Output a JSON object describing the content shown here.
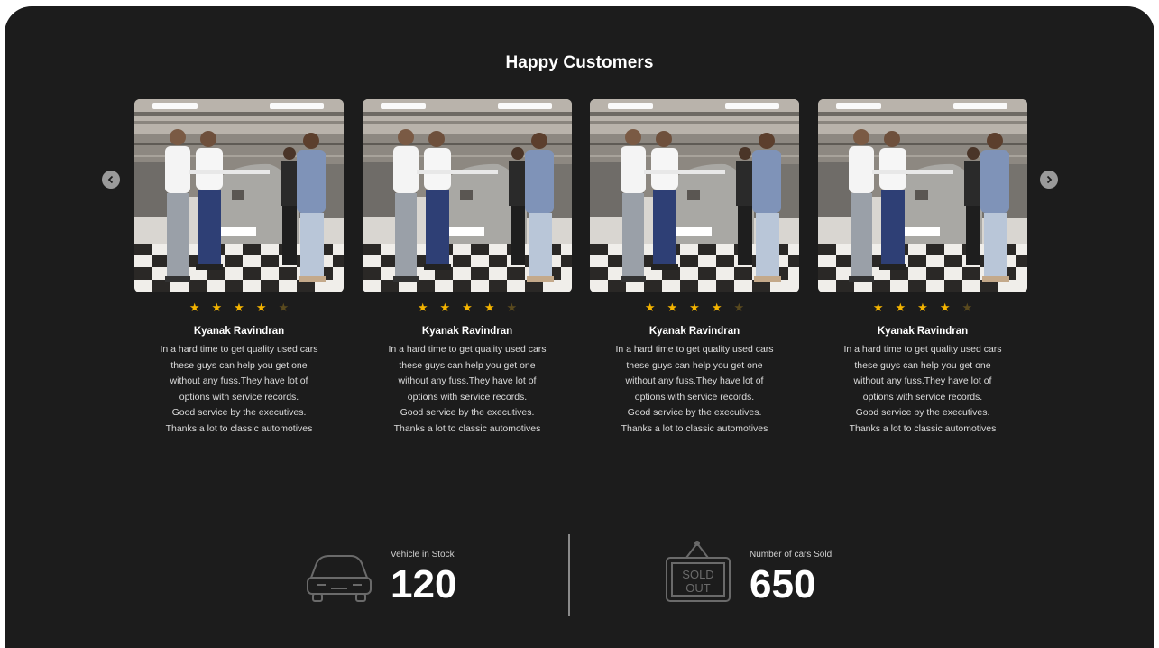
{
  "section": {
    "title": "Happy Customers"
  },
  "carousel": {
    "prev_icon": "chevron-left-icon",
    "next_icon": "chevron-right-icon",
    "cards": [
      {
        "rating": 4,
        "max_rating": 5,
        "name": "Kyanak Ravindran",
        "review": [
          "In a hard time to get quality used cars",
          "these guys can help you get one",
          "without any fuss.They have lot of",
          "options with service records.",
          "Good service by the executives.",
          "Thanks a lot to classic automotives"
        ]
      },
      {
        "rating": 4,
        "max_rating": 5,
        "name": "Kyanak Ravindran",
        "review": [
          "In a hard time to get quality used cars",
          "these guys can help you get one",
          "without any fuss.They have lot of",
          "options with service records.",
          "Good service by the executives.",
          "Thanks a lot to classic automotives"
        ]
      },
      {
        "rating": 4,
        "max_rating": 5,
        "name": "Kyanak Ravindran",
        "review": [
          "In a hard time to get quality used cars",
          "these guys can help you get one",
          "without any fuss.They have lot of",
          "options with service records.",
          "Good service by the executives.",
          "Thanks a lot to classic automotives"
        ]
      },
      {
        "rating": 4,
        "max_rating": 5,
        "name": "Kyanak Ravindran",
        "review": [
          "In a hard time to get quality used cars",
          "these guys can help you get one",
          "without any fuss.They have lot of",
          "options with service records.",
          "Good service by the executives.",
          "Thanks a lot to classic automotives"
        ]
      }
    ]
  },
  "stats": {
    "stock": {
      "label": "Vehicle in Stock",
      "value": "120",
      "icon": "car-icon"
    },
    "sold": {
      "label": "Number of cars Sold",
      "value": "650",
      "icon": "sold-out-tag-icon",
      "icon_text": [
        "SOLD",
        "OUT"
      ]
    }
  },
  "colors": {
    "panel": "#1c1c1c",
    "star": "#f4b400",
    "text": "#ffffff"
  }
}
